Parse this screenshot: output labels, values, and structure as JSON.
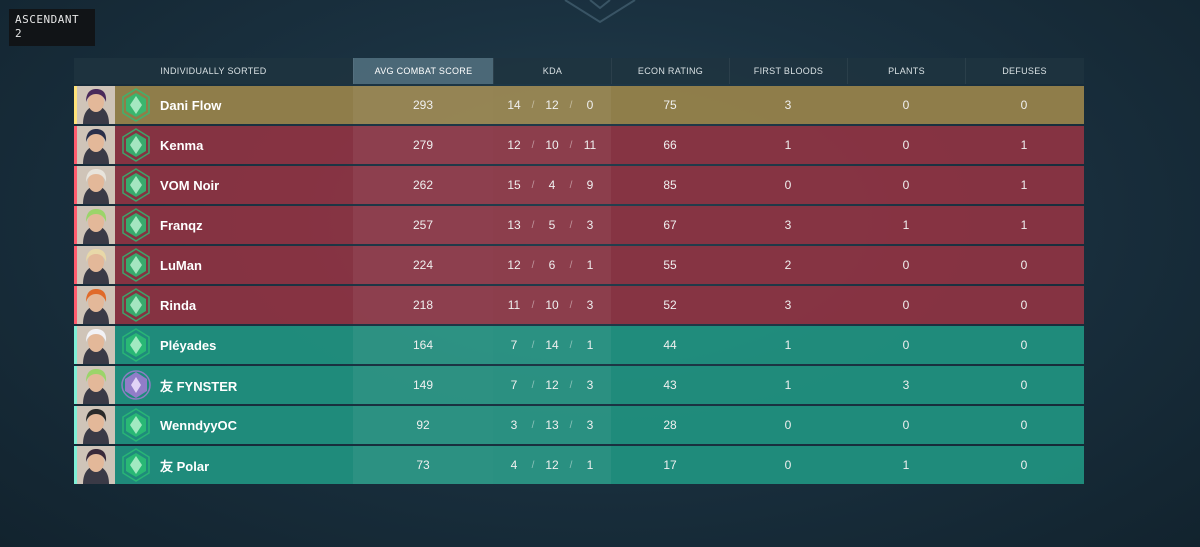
{
  "rank_label": "ASCENDANT 2",
  "columns": [
    "INDIVIDUALLY SORTED",
    "AVG COMBAT SCORE",
    "KDA",
    "ECON RATING",
    "FIRST BLOODS",
    "PLANTS",
    "DEFUSES"
  ],
  "active_column": "AVG COMBAT SCORE",
  "players": [
    {
      "name": "Dani Flow",
      "team": "self",
      "acs": "293",
      "k": "14",
      "d": "12",
      "a": "0",
      "econ": "75",
      "fb": "3",
      "plants": "0",
      "defuses": "0",
      "agent_hair": "#4a2a5a",
      "rank_icon": "ascendant-icon"
    },
    {
      "name": "Kenma",
      "team": "red",
      "acs": "279",
      "k": "12",
      "d": "10",
      "a": "11",
      "econ": "66",
      "fb": "1",
      "plants": "0",
      "defuses": "1",
      "agent_hair": "#2a2f4a",
      "rank_icon": "ascendant-icon"
    },
    {
      "name": "VOM Noir",
      "team": "red",
      "acs": "262",
      "k": "15",
      "d": "4",
      "a": "9",
      "econ": "85",
      "fb": "0",
      "plants": "0",
      "defuses": "1",
      "agent_hair": "#e8e4dc",
      "rank_icon": "ascendant-icon"
    },
    {
      "name": "Franqz",
      "team": "red",
      "acs": "257",
      "k": "13",
      "d": "5",
      "a": "3",
      "econ": "67",
      "fb": "3",
      "plants": "1",
      "defuses": "1",
      "agent_hair": "#9bd46a",
      "rank_icon": "ascendant-icon"
    },
    {
      "name": "LuMan",
      "team": "red",
      "acs": "224",
      "k": "12",
      "d": "6",
      "a": "1",
      "econ": "55",
      "fb": "2",
      "plants": "0",
      "defuses": "0",
      "agent_hair": "#e8d8a8",
      "rank_icon": "ascendant-icon"
    },
    {
      "name": "Rinda",
      "team": "red",
      "acs": "218",
      "k": "11",
      "d": "10",
      "a": "3",
      "econ": "52",
      "fb": "3",
      "plants": "0",
      "defuses": "0",
      "agent_hair": "#e06a2a",
      "rank_icon": "ascendant-icon"
    },
    {
      "name": "Pléyades",
      "team": "teal",
      "acs": "164",
      "k": "7",
      "d": "14",
      "a": "1",
      "econ": "44",
      "fb": "1",
      "plants": "0",
      "defuses": "0",
      "agent_hair": "#f2f2f6",
      "rank_icon": "ascendant-icon"
    },
    {
      "name": "友 FYNSTER",
      "team": "teal",
      "acs": "149",
      "k": "7",
      "d": "12",
      "a": "3",
      "econ": "43",
      "fb": "1",
      "plants": "3",
      "defuses": "0",
      "agent_hair": "#9bd46a",
      "rank_icon": "diamond-icon"
    },
    {
      "name": "WenndyyOC",
      "team": "teal",
      "acs": "92",
      "k": "3",
      "d": "13",
      "a": "3",
      "econ": "28",
      "fb": "0",
      "plants": "0",
      "defuses": "0",
      "agent_hair": "#2a2a2a",
      "rank_icon": "ascendant-icon"
    },
    {
      "name": "友 Polar",
      "team": "teal",
      "acs": "73",
      "k": "4",
      "d": "12",
      "a": "1",
      "econ": "17",
      "fb": "0",
      "plants": "1",
      "defuses": "0",
      "agent_hair": "#3a2a3a",
      "rank_icon": "ascendant-icon"
    }
  ],
  "colors": {
    "enemy_row": "#8e3443",
    "ally_row": "#209280",
    "self_row": "#96824b",
    "ascendant_green": "#2bbf74",
    "diamond_purple": "#a67ad6"
  }
}
